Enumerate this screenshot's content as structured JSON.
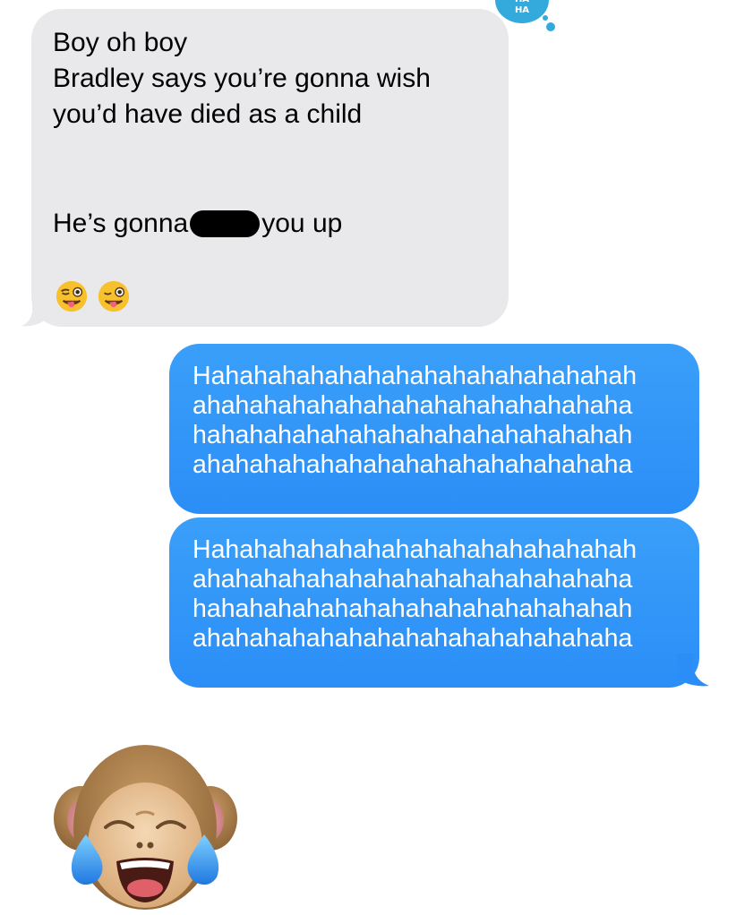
{
  "conversation": {
    "received": {
      "lines": [
        "Boy oh boy",
        "Bradley says you’re gonna wish",
        "you’d have died as a child"
      ],
      "line4_before": "He’s gonna",
      "line4_after": "you up",
      "emojis": "😜😜",
      "tapback": "HA HA"
    },
    "sent": [
      {
        "lines": [
          "Hahahahahahahahahahahahahahahah",
          "ahahahahahahahahahahahahahahaha",
          "hahahahahahahahahahahahahahahah",
          "ahahahahahahahahahahahahahahaha"
        ]
      },
      {
        "lines": [
          "Hahahahahahahahahahahahahahahah",
          "ahahahahahahahahahahahahahahaha",
          "hahahahahahahahahahahahahahahah",
          "ahahahahahahahahahahahahahahaha"
        ]
      }
    ],
    "sticker": "crying-laughing-monkey-memoji"
  },
  "colors": {
    "received_bubble": "#e9e9eb",
    "sent_bubble": "#2b8ef7",
    "tapback": "#34aadc",
    "redaction": "#000000"
  }
}
